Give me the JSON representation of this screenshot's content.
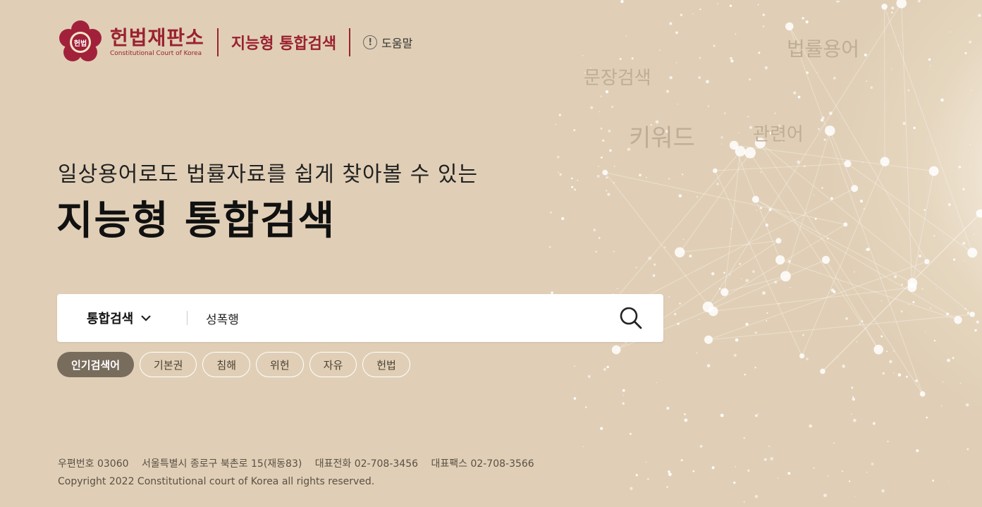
{
  "header": {
    "logo_emblem_text": "헌법",
    "logo_ko": "헌법재판소",
    "logo_en": "Constitutional Court of Korea",
    "service_title": "지능형 통합검색",
    "help_icon": "!",
    "help_label": "도움말"
  },
  "hero": {
    "subtitle": "일상용어로도 법률자료를 쉽게 찾아볼 수 있는",
    "title": "지능형 통합검색"
  },
  "word_cloud": {
    "w1": "법률용어",
    "w2": "문장검색",
    "w3": "키워드",
    "w4": "관련어"
  },
  "search": {
    "scope_label": "통합검색",
    "query": "성폭행",
    "placeholder": ""
  },
  "tags": {
    "heading": "인기검색어",
    "items": [
      "기본권",
      "침해",
      "위헌",
      "자유",
      "헌법"
    ]
  },
  "footer": {
    "postal": "우편번호 03060",
    "address": "서울특별시 종로구 북촌로 15(재동83)",
    "phone": "대표전화 02-708-3456",
    "fax": "대표팩스 02-708-3566",
    "copyright": "Copyright 2022 Constitutional court of Korea all rights reserved."
  },
  "colors": {
    "background": "#e0cfb6",
    "brand": "#9a2131",
    "tag_head": "#786c5d"
  }
}
